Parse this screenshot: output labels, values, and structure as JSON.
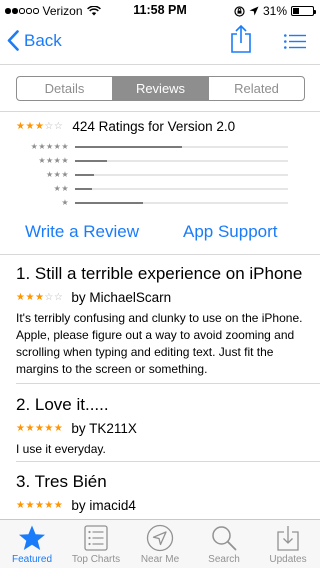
{
  "status": {
    "carrier": "Verizon",
    "time": "11:58 PM",
    "battery": "31%",
    "battery_level": 0.31,
    "signal_dots": [
      true,
      true,
      false,
      false,
      false
    ]
  },
  "nav": {
    "back_label": "Back",
    "share_icon": "share-icon",
    "list_icon": "list-icon"
  },
  "tabs_segmented": [
    {
      "label": "Details",
      "selected": false
    },
    {
      "label": "Reviews",
      "selected": true
    },
    {
      "label": "Related",
      "selected": false
    }
  ],
  "ratings": {
    "average_stars": 3,
    "summary": "424 Ratings for Version 2.0",
    "histogram": [
      {
        "stars": 5,
        "fraction": 0.5
      },
      {
        "stars": 4,
        "fraction": 0.15
      },
      {
        "stars": 3,
        "fraction": 0.09
      },
      {
        "stars": 2,
        "fraction": 0.08
      },
      {
        "stars": 1,
        "fraction": 0.32
      }
    ]
  },
  "actions": {
    "write_review": "Write a Review",
    "app_support": "App Support"
  },
  "reviews": [
    {
      "title": "1. Still a terrible experience on iPhone",
      "stars": 3,
      "byline": "by MichaelScarn",
      "body": "It's terribly confusing and clunky to use on the iPhone. Apple, please figure out a way to avoid zooming and scrolling when typing and editing text. Just fit the margins to the screen or something."
    },
    {
      "title": "2. Love it.....",
      "stars": 5,
      "byline": "by TK211X",
      "body": "I use it everyday."
    },
    {
      "title": "3. Tres Bién",
      "stars": 5,
      "byline": "by imacid4",
      "body": ""
    }
  ],
  "tab_bar": [
    {
      "label": "Featured",
      "icon": "star-icon",
      "active": true
    },
    {
      "label": "Top Charts",
      "icon": "top-charts-icon",
      "active": false
    },
    {
      "label": "Near Me",
      "icon": "near-me-icon",
      "active": false
    },
    {
      "label": "Search",
      "icon": "search-icon",
      "active": false
    },
    {
      "label": "Updates",
      "icon": "updates-icon",
      "active": false
    }
  ],
  "colors": {
    "accent": "#1a7cf9",
    "star": "#ff9500",
    "segment_gray": "#8e8e8e"
  }
}
